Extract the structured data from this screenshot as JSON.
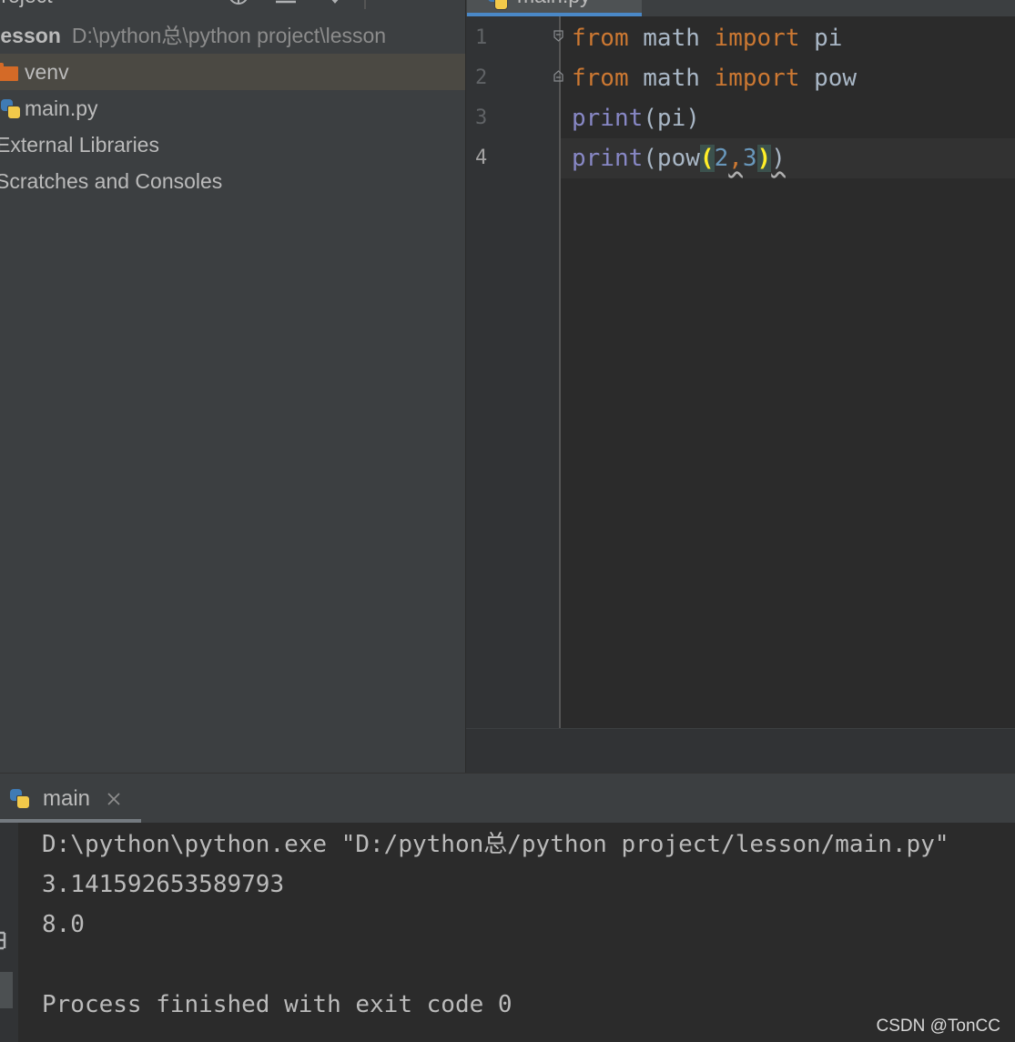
{
  "project_panel": {
    "title": "Project",
    "root": {
      "name": "lesson",
      "path": "D:\\python总\\python project\\lesson"
    },
    "items": [
      {
        "label": "venv",
        "icon": "folder-icon",
        "selected": true
      },
      {
        "label": "main.py",
        "icon": "python-file-icon",
        "selected": false
      },
      {
        "label": "External Libraries",
        "icon": "library-icon",
        "selected": false
      },
      {
        "label": "Scratches and Consoles",
        "icon": "scratches-icon",
        "selected": false
      }
    ]
  },
  "editor": {
    "tab": "main.py",
    "current_line": 4,
    "lines": [
      {
        "number": "1",
        "fold": "start",
        "tokens": [
          {
            "type": "keyword",
            "text": "from"
          },
          {
            "type": "plain",
            "text": " math "
          },
          {
            "type": "keyword",
            "text": "import"
          },
          {
            "type": "plain",
            "text": " pi"
          }
        ]
      },
      {
        "number": "2",
        "fold": "end",
        "tokens": [
          {
            "type": "keyword",
            "text": "from"
          },
          {
            "type": "plain",
            "text": " math "
          },
          {
            "type": "keyword",
            "text": "import"
          },
          {
            "type": "plain",
            "text": " pow"
          }
        ]
      },
      {
        "number": "3",
        "fold": "",
        "tokens": [
          {
            "type": "builtin",
            "text": "print"
          },
          {
            "type": "plain",
            "text": "(pi)"
          }
        ]
      },
      {
        "number": "4",
        "fold": "",
        "tokens": [
          {
            "type": "builtin",
            "text": "print"
          },
          {
            "type": "plain",
            "text": "(pow"
          },
          {
            "type": "brace",
            "text": "("
          },
          {
            "type": "number",
            "text": "2"
          },
          {
            "type": "comma",
            "text": ","
          },
          {
            "type": "number",
            "text": "3"
          },
          {
            "type": "brace",
            "text": ")"
          },
          {
            "type": "squiggle",
            "text": ")"
          }
        ]
      }
    ]
  },
  "run": {
    "tab": "main",
    "output": [
      "D:\\python\\python.exe \"D:/python总/python project/lesson/main.py\"",
      "3.141592653589793",
      "8.0",
      "",
      "Process finished with exit code 0"
    ]
  },
  "watermark": "CSDN @TonCC",
  "colors": {
    "keyword": "#cc7832",
    "builtin": "#8888c6",
    "number": "#6897bb",
    "identifier": "#a9b7c6",
    "folder": "#d46a27",
    "tab_underline": "#4a88c7"
  }
}
